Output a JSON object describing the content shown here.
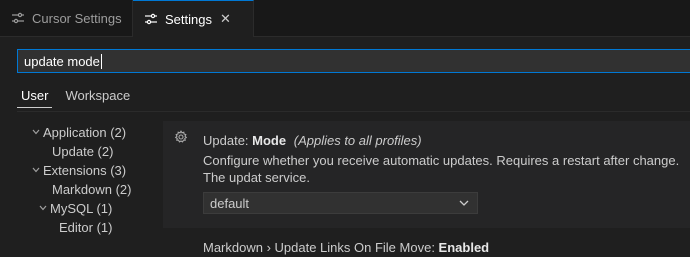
{
  "tabs": [
    {
      "label": "Cursor Settings",
      "icon": "settings-lines-icon",
      "active": false
    },
    {
      "label": "Settings",
      "icon": "settings-lines-icon",
      "active": true,
      "close_glyph": "✕"
    }
  ],
  "search": {
    "value": "update mode"
  },
  "scope_tabs": [
    "User",
    "Workspace"
  ],
  "toc": [
    {
      "label": "Application (2)",
      "expanded": true
    },
    {
      "label": "Update (2)"
    },
    {
      "label": "Extensions (3)",
      "expanded": true
    },
    {
      "label": "Markdown (2)"
    },
    {
      "label": "MySQL (1)",
      "expanded": true
    },
    {
      "label": "Editor (1)"
    }
  ],
  "setting_update_mode": {
    "category": "Update: ",
    "name": "Mode",
    "scope_note": "(Applies to all profiles)",
    "description": "Configure whether you receive automatic updates. Requires a restart after change. The updat service.",
    "value": "default"
  },
  "setting_markdown": {
    "category": "Markdown › Update Links On File Move: ",
    "name": "Enabled"
  },
  "colors": {
    "accent": "#0078d4",
    "background": "#1f1f1f"
  }
}
